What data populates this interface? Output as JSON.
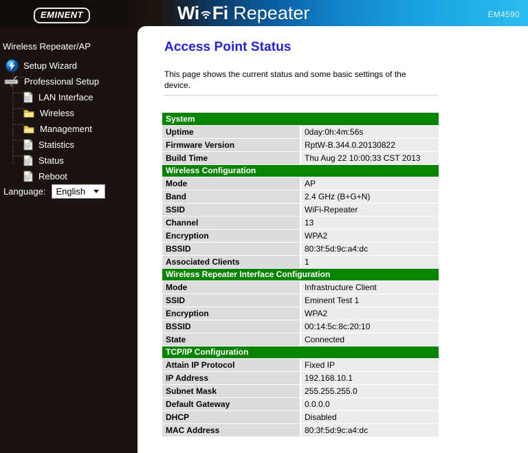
{
  "header": {
    "logo_text": "EMINENT",
    "logo_icon": "eminent-logo",
    "brand_prefix": "Wi",
    "brand_suffix": "Fi",
    "brand_word": "Repeater",
    "wifi_icon": "wifi-signal-icon",
    "model": "EM4590"
  },
  "sidebar": {
    "title": "Wireless Repeater/AP",
    "items": [
      {
        "label": "Setup Wizard",
        "icon": "wizard-bolt-icon",
        "level": 0
      },
      {
        "label": "Professional Setup",
        "icon": "router-device-icon",
        "level": 0
      },
      {
        "label": "LAN Interface",
        "icon": "document-icon",
        "level": 1
      },
      {
        "label": "Wireless",
        "icon": "folder-icon",
        "level": 1
      },
      {
        "label": "Management",
        "icon": "folder-icon",
        "level": 1
      },
      {
        "label": "Statistics",
        "icon": "document-icon",
        "level": 1
      },
      {
        "label": "Status",
        "icon": "document-icon",
        "level": 1
      },
      {
        "label": "Reboot",
        "icon": "document-icon",
        "level": 1
      }
    ],
    "language_label": "Language:",
    "language_value": "English",
    "language_options": [
      "English"
    ],
    "dropdown_icon": "chevron-down-icon"
  },
  "main": {
    "title": "Access Point Status",
    "description": "This page shows the current status and some basic settings of the device.",
    "sections": [
      {
        "heading": "System",
        "rows": [
          {
            "key": "Uptime",
            "value": "0day:0h:4m:56s"
          },
          {
            "key": "Firmware Version",
            "value": "RptW-B.344.0.20130822"
          },
          {
            "key": "Build Time",
            "value": "Thu Aug 22 10:00:33 CST 2013"
          }
        ]
      },
      {
        "heading": "Wireless Configuration",
        "rows": [
          {
            "key": "Mode",
            "value": "AP"
          },
          {
            "key": "Band",
            "value": "2.4 GHz (B+G+N)"
          },
          {
            "key": "SSID",
            "value": "WiFi-Repeater"
          },
          {
            "key": "Channel",
            "value": "13"
          },
          {
            "key": "Encryption",
            "value": "WPA2"
          },
          {
            "key": "BSSID",
            "value": "80:3f:5d:9c:a4:dc"
          },
          {
            "key": "Associated Clients",
            "value": "1"
          }
        ]
      },
      {
        "heading": "Wireless Repeater Interface Configuration",
        "rows": [
          {
            "key": "Mode",
            "value": "Infrastructure Client"
          },
          {
            "key": "SSID",
            "value": "Eminent Test 1"
          },
          {
            "key": "Encryption",
            "value": "WPA2"
          },
          {
            "key": "BSSID",
            "value": "00:14:5c:8c:20:10"
          },
          {
            "key": "State",
            "value": "Connected"
          }
        ]
      },
      {
        "heading": "TCP/IP Configuration",
        "rows": [
          {
            "key": "Attain IP Protocol",
            "value": "Fixed IP"
          },
          {
            "key": "IP Address",
            "value": "192.168.10.1"
          },
          {
            "key": "Subnet Mask",
            "value": "255.255.255.0"
          },
          {
            "key": "Default Gateway",
            "value": "0.0.0.0"
          },
          {
            "key": "DHCP",
            "value": "Disabled"
          },
          {
            "key": "MAC Address",
            "value": "80:3f:5d:9c:a4:dc"
          }
        ]
      }
    ]
  },
  "colors": {
    "section_green": "#088400",
    "title_blue": "#2222dd",
    "sidebar_bg": "#1b130f",
    "key_cell": "#dcdcdc",
    "value_cell": "#ececec"
  }
}
